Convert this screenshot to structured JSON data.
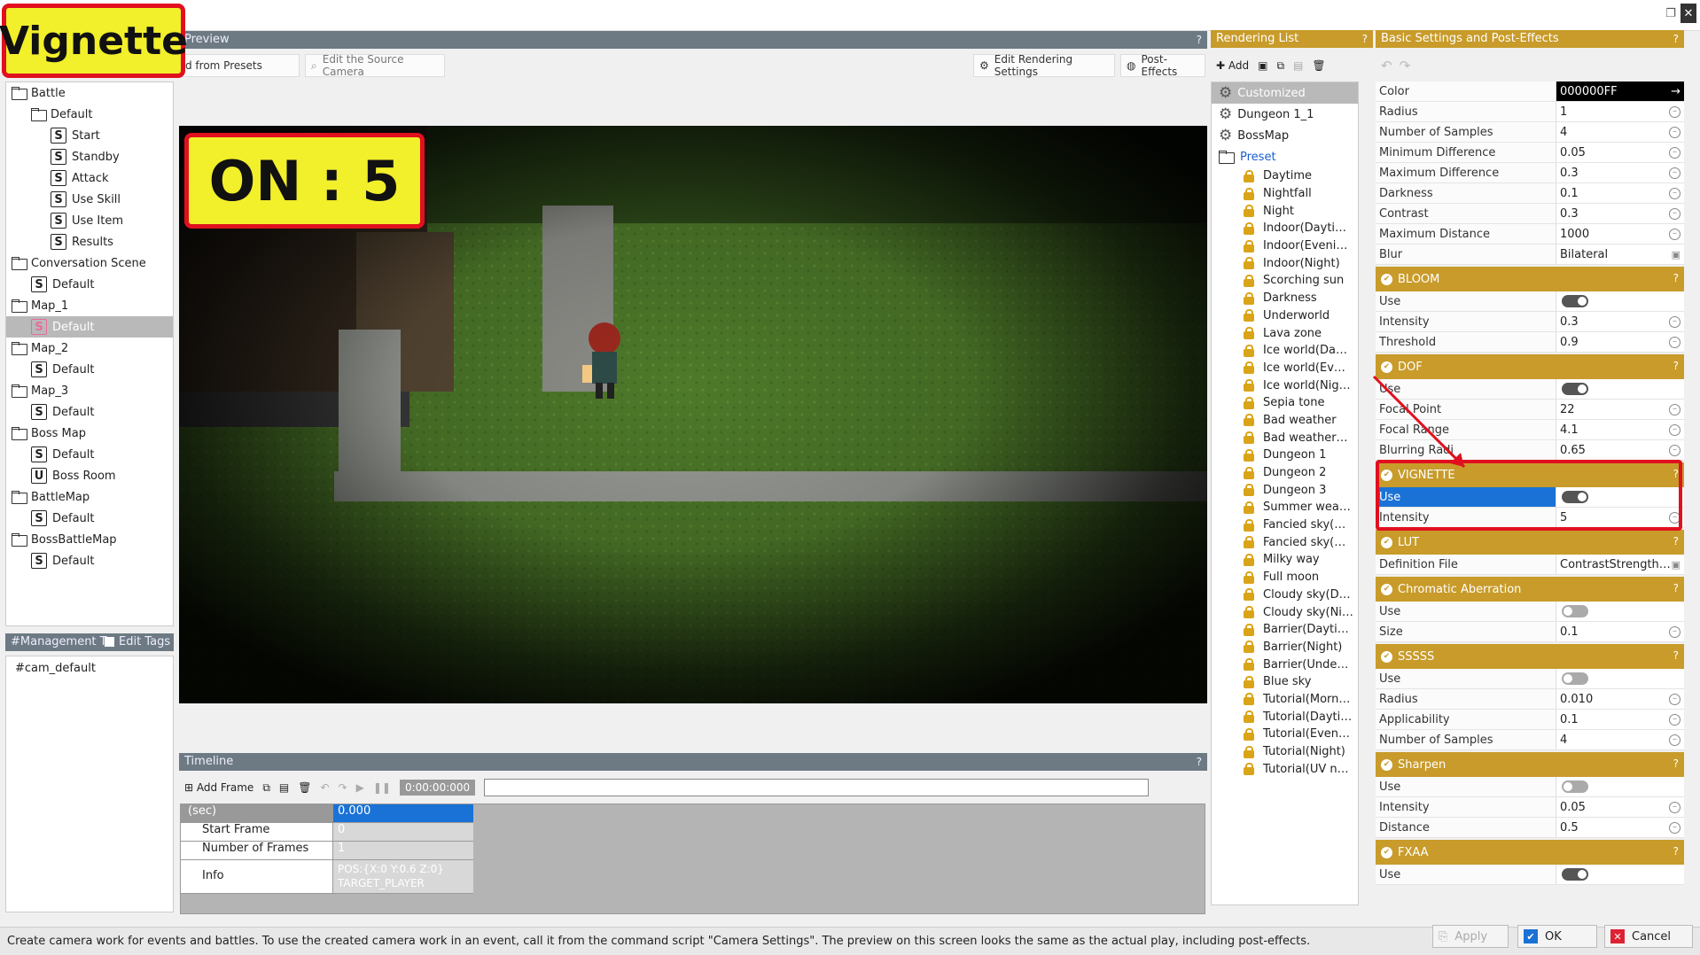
{
  "badges": {
    "main": "Vignette",
    "value": "ON : 5"
  },
  "preview": {
    "header": "Preview",
    "btn_presets": "d from Presets",
    "btn_source": "Edit the Source Camera",
    "btn_render": "Edit Rendering Settings",
    "btn_post": "Post-Effects"
  },
  "tree": [
    {
      "label": "Battle",
      "type": "folder",
      "indent": 0
    },
    {
      "label": "Default",
      "type": "folder",
      "indent": 1
    },
    {
      "label": "Start",
      "type": "s",
      "indent": 2
    },
    {
      "label": "Standby",
      "type": "s",
      "indent": 2
    },
    {
      "label": "Attack",
      "type": "s",
      "indent": 2
    },
    {
      "label": "Use Skill",
      "type": "s",
      "indent": 2
    },
    {
      "label": "Use Item",
      "type": "s",
      "indent": 2
    },
    {
      "label": "Results",
      "type": "s",
      "indent": 2
    },
    {
      "label": "Conversation Scene",
      "type": "folder",
      "indent": 0
    },
    {
      "label": "Default",
      "type": "s",
      "indent": 1
    },
    {
      "label": "Map_1",
      "type": "folder",
      "indent": 0
    },
    {
      "label": "Default",
      "type": "s",
      "indent": 1,
      "selected": true
    },
    {
      "label": "Map_2",
      "type": "folder",
      "indent": 0
    },
    {
      "label": "Default",
      "type": "s",
      "indent": 1
    },
    {
      "label": "Map_3",
      "type": "folder",
      "indent": 0
    },
    {
      "label": "Default",
      "type": "s",
      "indent": 1
    },
    {
      "label": "Boss Map",
      "type": "folder",
      "indent": 0
    },
    {
      "label": "Default",
      "type": "s",
      "indent": 1
    },
    {
      "label": "Boss Room",
      "type": "u",
      "indent": 1
    },
    {
      "label": "BattleMap",
      "type": "folder",
      "indent": 0
    },
    {
      "label": "Default",
      "type": "s",
      "indent": 1
    },
    {
      "label": "BossBattleMap",
      "type": "folder",
      "indent": 0
    },
    {
      "label": "Default",
      "type": "s",
      "indent": 1
    }
  ],
  "management": {
    "header": "#Management T",
    "edit_tags": "Edit Tags",
    "tag": "#cam_default"
  },
  "timeline": {
    "header": "Timeline",
    "add_frame": "Add Frame",
    "time": "0:00:00:000",
    "rows": [
      {
        "key": "(sec)",
        "value": "0.000"
      },
      {
        "key": "Start Frame",
        "value": "0"
      },
      {
        "key": "Number of Frames",
        "value": "1"
      },
      {
        "key": "Info",
        "value": "POS:{X:0 Y:0.6 Z:0}",
        "value2": "TARGET_PLAYER"
      }
    ]
  },
  "rendering_list": {
    "header": "Rendering List",
    "add": "Add",
    "custom": [
      {
        "label": "Customized",
        "selected": true
      },
      {
        "label": "Dungeon 1_1"
      },
      {
        "label": "BossMap"
      }
    ],
    "preset_label": "Preset",
    "presets": [
      "Daytime",
      "Nightfall",
      "Night",
      "Indoor(Dayti…",
      "Indoor(Eveni…",
      "Indoor(Night)",
      "Scorching sun",
      "Darkness",
      "Underworld",
      "Lava zone",
      "Ice world(Da…",
      "Ice world(Ev…",
      "Ice world(Nig…",
      "Sepia tone",
      "Bad weather",
      "Bad weather…",
      "Dungeon 1",
      "Dungeon 2",
      "Dungeon 3",
      "Summer wea…",
      "Fancied sky(…",
      "Fancied sky(…",
      "Milky way",
      "Full moon",
      "Cloudy sky(D…",
      "Cloudy sky(Ni…",
      "Barrier(Dayti…",
      "Barrier(Night)",
      "Barrier(Unde…",
      "Blue sky",
      "Tutorial(Morn…",
      "Tutorial(Dayti…",
      "Tutorial(Even…",
      "Tutorial(Night)",
      "Tutorial(UV n…"
    ]
  },
  "settings": {
    "header": "Basic Settings and Post-Effects",
    "top_rows": [
      {
        "k": "Color",
        "v": "000000FF",
        "style": "color"
      },
      {
        "k": "Radius",
        "v": "1"
      },
      {
        "k": "Number of Samples",
        "v": "4"
      },
      {
        "k": "Minimum Difference",
        "v": "0.05"
      },
      {
        "k": "Maximum Difference",
        "v": "0.3"
      },
      {
        "k": "Darkness",
        "v": "0.1"
      },
      {
        "k": "Contrast",
        "v": "0.3"
      },
      {
        "k": "Maximum Distance",
        "v": "1000"
      },
      {
        "k": "Blur",
        "v": "Bilateral",
        "style": "select"
      }
    ],
    "sections": [
      {
        "title": "BLOOM",
        "rows": [
          {
            "k": "Use",
            "toggle": "on"
          },
          {
            "k": "Intensity",
            "v": "0.3"
          },
          {
            "k": "Threshold",
            "v": "0.9"
          }
        ]
      },
      {
        "title": "DOF",
        "rows": [
          {
            "k": "Use",
            "toggle": "on"
          },
          {
            "k": "Focal Point",
            "v": "22"
          },
          {
            "k": "Focal Range",
            "v": "4.1"
          },
          {
            "k": "Blurring Radi",
            "v": "0.65"
          }
        ]
      },
      {
        "title": "VIGNETTE",
        "highlight": true,
        "rows": [
          {
            "k": "Use",
            "toggle": "on",
            "selected": true
          },
          {
            "k": "Intensity",
            "v": "5"
          }
        ]
      },
      {
        "title": "LUT",
        "rows": [
          {
            "k": "Definition File",
            "v": "ContrastStrength…",
            "style": "select"
          }
        ]
      },
      {
        "title": "Chromatic Aberration",
        "rows": [
          {
            "k": "Use",
            "toggle": "off"
          },
          {
            "k": "Size",
            "v": "0.1"
          }
        ]
      },
      {
        "title": "SSSSS",
        "rows": [
          {
            "k": "Use",
            "toggle": "off"
          },
          {
            "k": "Radius",
            "v": "0.010"
          },
          {
            "k": "Applicability",
            "v": "0.1"
          },
          {
            "k": "Number of Samples",
            "v": "4"
          }
        ]
      },
      {
        "title": "Sharpen",
        "rows": [
          {
            "k": "Use",
            "toggle": "off"
          },
          {
            "k": "Intensity",
            "v": "0.05"
          },
          {
            "k": "Distance",
            "v": "0.5"
          }
        ]
      },
      {
        "title": "FXAA",
        "rows": [
          {
            "k": "Use",
            "toggle": "on"
          }
        ]
      }
    ]
  },
  "status": "Create camera work for events and battles. To use the created camera work in an event, call it from the command script \"Camera Settings\". The preview on this screen looks the same as the actual play, including post-effects.",
  "footer": {
    "apply": "Apply",
    "ok": "OK",
    "cancel": "Cancel"
  },
  "colors": {
    "gold": "#c89b2a",
    "highlight": "#e0101f",
    "badge": "#f2ef2b",
    "select": "#1a72d6"
  }
}
